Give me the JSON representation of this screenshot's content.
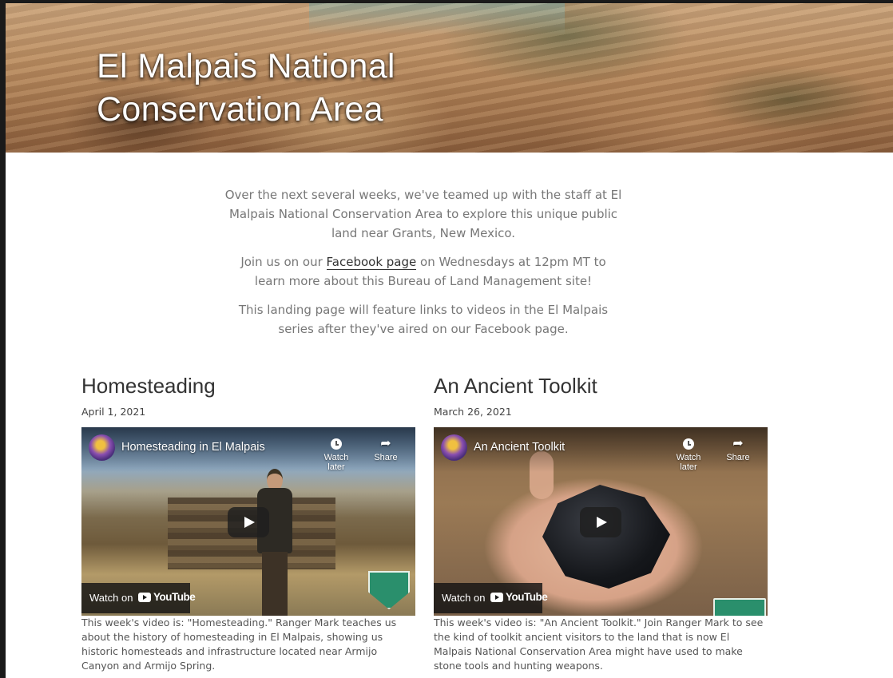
{
  "hero": {
    "title_line1": "El Malpais National",
    "title_line2": "Conservation Area"
  },
  "intro": {
    "p1": "Over the next several weeks, we've teamed up with the staff at El Malpais National Conservation Area to explore this unique public land near Grants, New Mexico.",
    "p2_before": "Join us on our ",
    "p2_link": "Facebook page",
    "p2_after": " on Wednesdays at 12pm MT to learn more about this Bureau of Land Management site!",
    "p3": "This landing page will feature links to videos in the El Malpais series after they've aired on our Facebook page."
  },
  "videos": [
    {
      "heading": "Homesteading",
      "date": "April 1, 2021",
      "player_title": "Homesteading in El Malpais",
      "watch_later": "Watch later",
      "share": "Share",
      "watch_on": "Watch on",
      "youtube": "YouTube",
      "caption": "This week's video is: \"Homesteading.\" Ranger Mark teaches us about the history of homesteading in El Malpais, showing us historic homesteads and infrastructure located near Armijo Canyon and Armijo Spring."
    },
    {
      "heading": "An Ancient Toolkit",
      "date": "March 26, 2021",
      "player_title": "An Ancient Toolkit",
      "watch_later": "Watch later",
      "share": "Share",
      "watch_on": "Watch on",
      "youtube": "YouTube",
      "caption": "This week's video is: \"An Ancient Toolkit.\" Join Ranger Mark to see the kind of toolkit ancient visitors to the land that is now El Malpais National Conservation Area might have used to make stone tools and hunting weapons."
    }
  ],
  "icons": {
    "clock": "clock-icon",
    "share": "share-arrow-icon",
    "play": "play-icon",
    "youtube": "youtube-logo-icon"
  },
  "colors": {
    "heading": "#333333",
    "intro_text": "#777777",
    "link": "#333333",
    "badge_green": "#2a8f6c"
  }
}
